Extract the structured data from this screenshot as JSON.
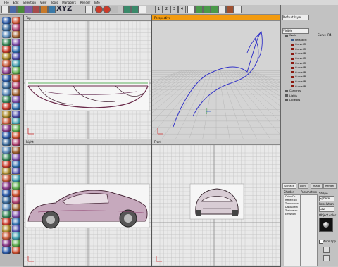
{
  "menu": [
    "File",
    "Edit",
    "Selection",
    "View",
    "Tools",
    "Managers",
    "Render",
    "Info"
  ],
  "toolbar": {
    "axis_label": "XYZ",
    "page_numbers": [
      "1",
      "2",
      "3",
      "4"
    ]
  },
  "viewports": {
    "top_left": {
      "title": "Top",
      "label_right": "Gt"
    },
    "top_right": {
      "title": "Perspective",
      "label_right": ""
    },
    "bottom_left": {
      "title": "Right",
      "label_right": "Gt"
    },
    "bottom_right": {
      "title": "Front",
      "label_right": "Gt"
    }
  },
  "object_manager": {
    "layer_field": "Default layer",
    "filter_field": "Visible",
    "selected_label": "Curve IR4",
    "tree": [
      "World",
      "Perspecti",
      "Curve IR",
      "Curve IR",
      "Curve IR",
      "Curve IR",
      "Curve IR",
      "Curve IR",
      "Curve IR",
      "Curve IR",
      "Curve IR",
      "Curve IR",
      "Cameras",
      "Lights",
      "Locators"
    ]
  },
  "attributes": {
    "tabs": [
      "Surface",
      "Light",
      "Image",
      "Render"
    ],
    "shader_title": "Shader",
    "shader_list": [
      "Color Ch",
      "Reflection",
      "Transparen",
      "Displacem",
      "Texture sp",
      "Emission"
    ],
    "parameters_title": "Parameters",
    "shape_title": "Shape",
    "shape_value": "Sphere",
    "resolution_title": "Resolution",
    "resolution_value": "Low",
    "object_color_title": "Object color",
    "auto_apply_label": "Auto app"
  },
  "colors": {
    "active_header": "#f29b10",
    "grid_bg": "#e9e9e9",
    "curve_blue": "#3333c8"
  }
}
